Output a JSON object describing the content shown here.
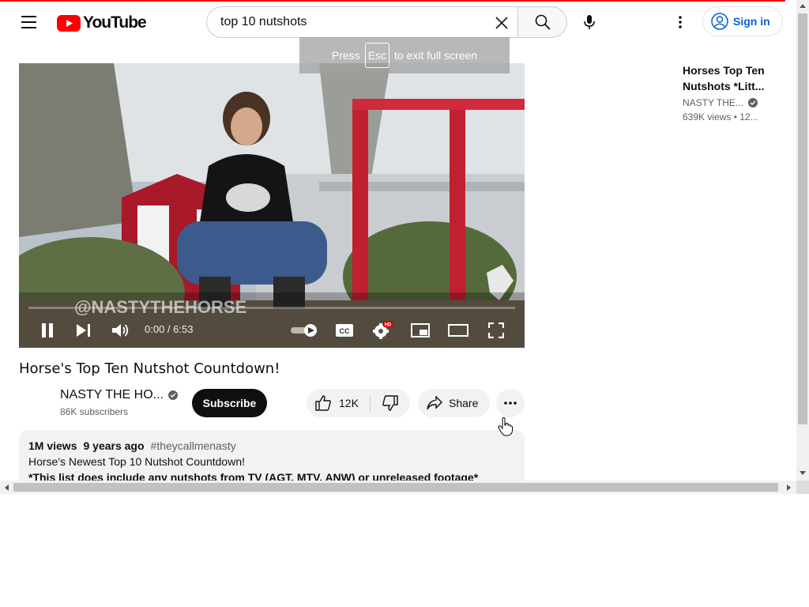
{
  "masthead": {
    "logo_text": "YouTube",
    "search_value": "top 10 nutshots",
    "signin_label": "Sign in"
  },
  "fullscreen_hint": {
    "press": "Press",
    "key": "Esc",
    "rest": "to exit full screen"
  },
  "player": {
    "watermark": "@NASTYTHEHORSE",
    "time": "0:00 / 6:53",
    "progress": 0.0,
    "hd_badge": "HD"
  },
  "video": {
    "title": "Horse's Top Ten Nutshot Countdown!",
    "channel": "NASTY THE HO...",
    "subscribers": "86K subscribers",
    "subscribe_label": "Subscribe",
    "likes": "12K",
    "share_label": "Share"
  },
  "description": {
    "views": "1M views",
    "age": "9 years ago",
    "hashtag": "#theycallmenasty",
    "line1": "Horse's Newest Top 10 Nutshot Countdown!",
    "line2": "*This list does include any nutshots from TV (AGT, MTV, ANW) or unreleased footage*"
  },
  "sidebar": {
    "items": [
      {
        "title_line1": "Horses Top Ten",
        "title_line2": "Nutshots *Litt...",
        "channel": "NASTY THE...",
        "views": "639K views",
        "age": "• 12..."
      }
    ]
  },
  "colors": {
    "brand_red": "#ff0000",
    "link_blue": "#065fd4",
    "chip_bg": "#f2f2f2",
    "subscribe_bg": "#0f0f0f"
  }
}
